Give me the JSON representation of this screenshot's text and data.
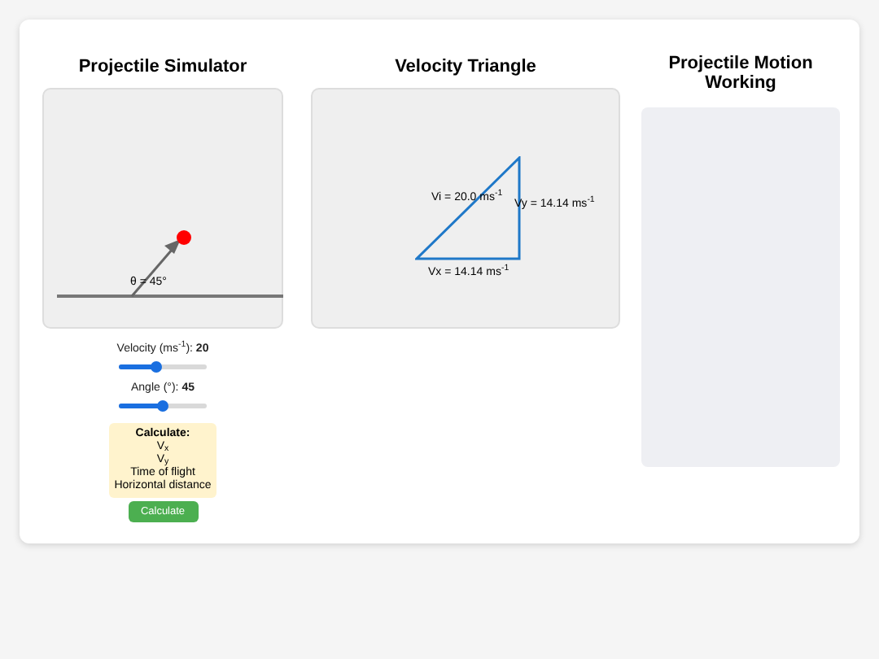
{
  "simulator": {
    "title": "Projectile Simulator",
    "angle_label": "θ = 45°",
    "sliders": [
      {
        "label": "Velocity (ms$^{-1}$): ",
        "value": "20",
        "level": 0.43
      },
      {
        "label": "Angle (°): ",
        "value": "45",
        "level": 0.5
      }
    ],
    "calculate": {
      "title": "Calculate:",
      "items": [
        "V$_{x}$",
        "V$_{y}$",
        "Time of flight",
        "Horizontal distance"
      ]
    },
    "button": "Calculate"
  },
  "triangle": {
    "title": "Velocity Triangle",
    "vi": "Vi = 20.0 ms$^{-1}$",
    "vy": "Vy = 14.14 ms$^{-1}$",
    "vx": "Vx = 14.14 ms$^{-1}$"
  },
  "working": {
    "title": "Projectile Motion Working"
  }
}
